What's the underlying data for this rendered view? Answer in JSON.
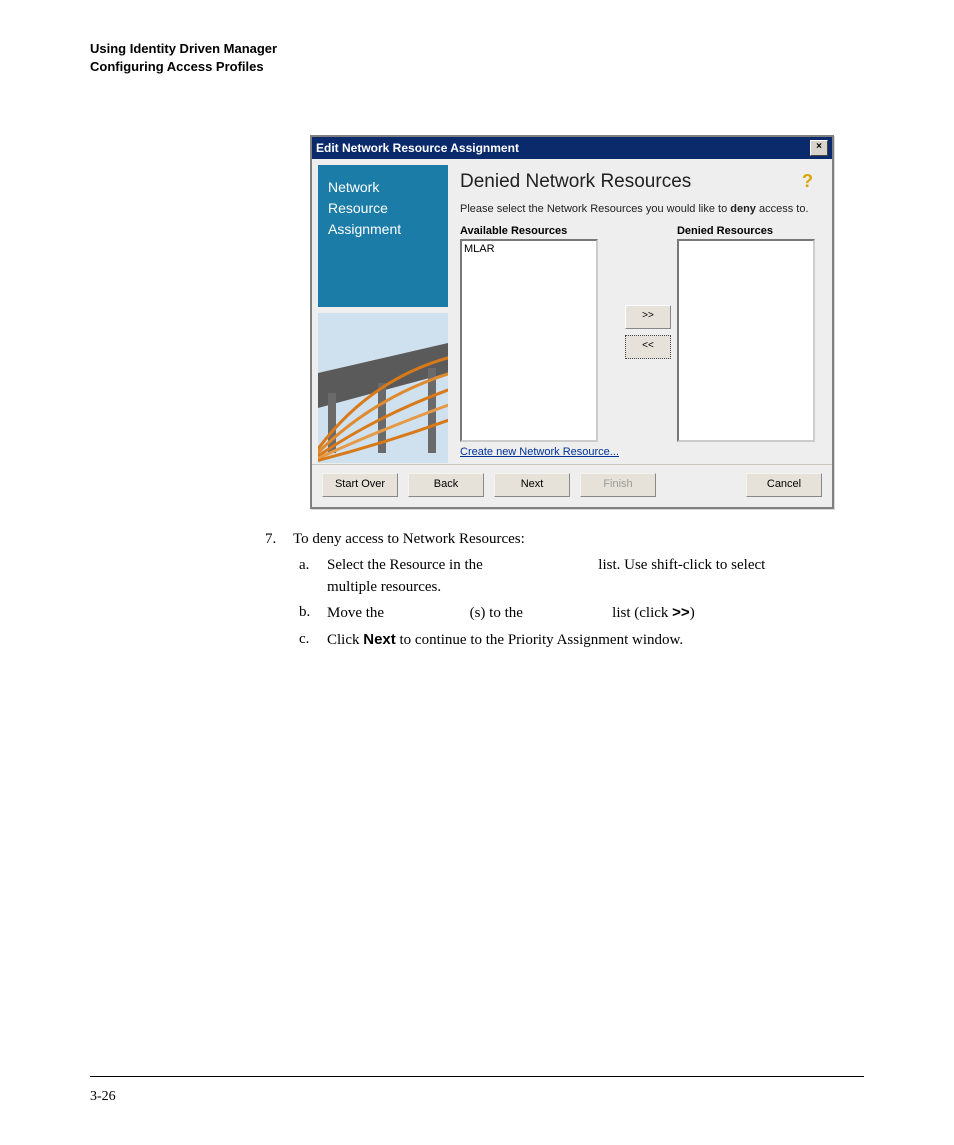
{
  "header": {
    "line1": "Using Identity Driven Manager",
    "line2": "Configuring Access Profiles"
  },
  "dialog": {
    "title": "Edit Network Resource Assignment",
    "close_glyph": "×",
    "sidebar_title": "Network\nResource\nAssignment",
    "content_title": "Denied Network Resources",
    "help_glyph": "?",
    "description_pre": "Please select the Network Resources you would like to ",
    "description_bold": "deny",
    "description_post": " access to.",
    "available_label": "Available Resources",
    "denied_label": "Denied Resources",
    "available_items": [
      "MLAR"
    ],
    "denied_items": [],
    "move_right": ">>",
    "move_left": "<<",
    "create_link": "Create new Network Resource...",
    "buttons": {
      "start_over": "Start Over",
      "back": "Back",
      "next": "Next",
      "finish": "Finish",
      "cancel": "Cancel"
    }
  },
  "instructions": {
    "step_number": "7.",
    "step_text": "To deny access to Network Resources:",
    "a_letter": "a.",
    "a_pre": "Select the Resource in the ",
    "a_post": " list. Use shift-click to select multiple resources.",
    "b_letter": "b.",
    "b_pre": "Move the ",
    "b_mid": "(s) to the ",
    "b_post": " list (click ",
    "b_symbol": ">>",
    "b_close": ")",
    "c_letter": "c.",
    "c_pre": "Click ",
    "c_bold": "Next",
    "c_post": " to continue to the Priority Assignment window."
  },
  "page_number": "3-26"
}
